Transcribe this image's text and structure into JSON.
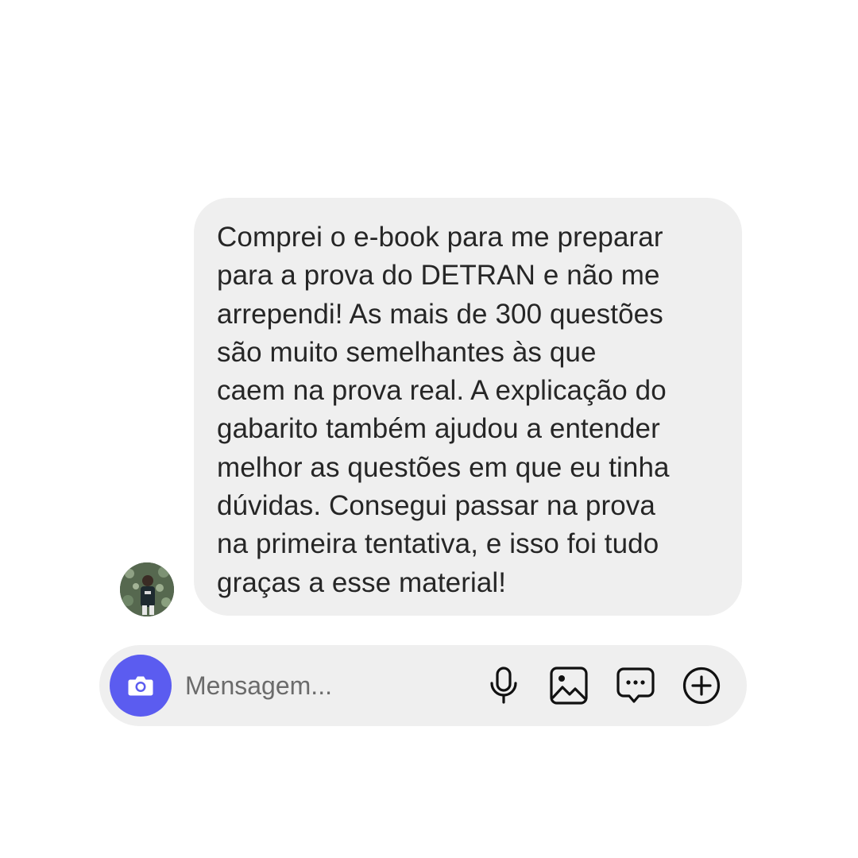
{
  "message": {
    "lines": [
      "Comprei o e-book para me preparar",
      "para a prova do DETRAN e não me",
      "arrependi! As mais de 300 questões",
      "são muito semelhantes às que",
      "caem na prova real. A explicação do",
      "gabarito também ajudou a entender",
      "melhor as questões em que eu tinha",
      "dúvidas. Consegui passar na prova",
      "na primeira tentativa, e isso foi tudo",
      "graças a esse material!"
    ]
  },
  "composer": {
    "placeholder": "Mensagem...",
    "value": ""
  },
  "icons": {
    "camera": "camera-icon",
    "microphone": "microphone-icon",
    "gallery": "gallery-icon",
    "sticker": "chat-bubble-dots-icon",
    "plus": "plus-circle-icon"
  },
  "colors": {
    "accent": "#5b5cf0",
    "bubble": "#efefef",
    "text": "#262626",
    "placeholder": "#6b6b6b"
  }
}
